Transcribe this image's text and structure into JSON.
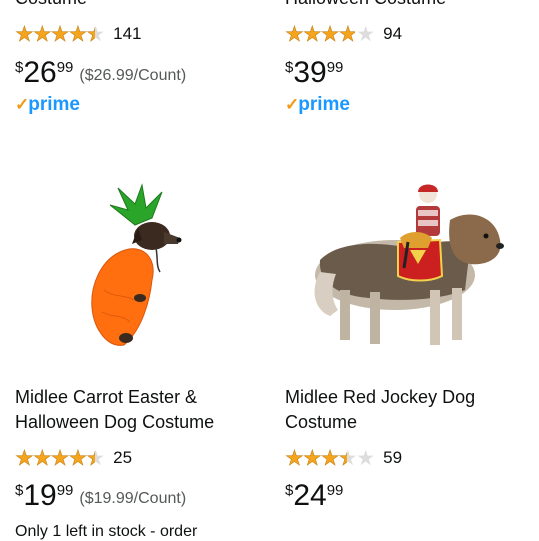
{
  "products": [
    {
      "title_lines": [
        "Costume",
        ""
      ],
      "rating": 4.5,
      "reviews": "141",
      "price": {
        "symbol": "$",
        "whole": "26",
        "fraction": "99",
        "unit_price": "($26.99/Count)"
      },
      "prime": "prime"
    },
    {
      "title_lines": [
        "Halloween Costume",
        ""
      ],
      "rating": 4.0,
      "reviews": "94",
      "price": {
        "symbol": "$",
        "whole": "39",
        "fraction": "99"
      },
      "prime": "prime"
    },
    {
      "title_lines": [
        "Midlee Carrot Easter &",
        "Halloween Dog Costume"
      ],
      "rating": 4.5,
      "reviews": "25",
      "price": {
        "symbol": "$",
        "whole": "19",
        "fraction": "99",
        "unit_price": "($19.99/Count)"
      },
      "stock": "Only 1 left in stock - order"
    },
    {
      "title_lines": [
        "Midlee Red Jockey Dog",
        "Costume"
      ],
      "rating": 3.5,
      "reviews": "59",
      "price": {
        "symbol": "$",
        "whole": "24",
        "fraction": "99"
      }
    }
  ],
  "icons": {
    "star": "star-icon",
    "prime_check": "prime-check-icon"
  },
  "colors": {
    "star": "#f4a41d",
    "prime": "#1a98ff",
    "prime_check": "#f39a14",
    "unit_price": "#565959"
  }
}
